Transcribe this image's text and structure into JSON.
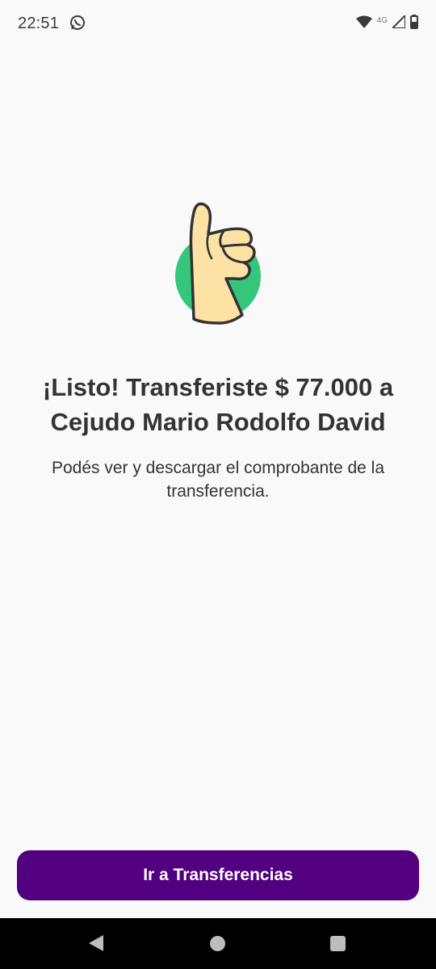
{
  "status_bar": {
    "time": "22:51",
    "network_label": "4G",
    "icons": [
      "whatsapp-icon",
      "wifi-icon",
      "signal-icon",
      "battery-icon"
    ]
  },
  "colors": {
    "accent": "#520080",
    "success_circle": "#34c77b",
    "hand_fill": "#fce3a5",
    "background": "#f9f9f9"
  },
  "illustration": {
    "icon": "thumbs-up-icon"
  },
  "confirmation": {
    "title_line1": "¡Listo! Transferiste $ 77.000 a",
    "title_line2": "Cejudo Mario Rodolfo David",
    "subtitle_line1": "Podés ver y descargar el comprobante de la",
    "subtitle_line2": "transferencia."
  },
  "actions": {
    "primary_label": "Ir a Transferencias"
  },
  "nav": {
    "icons": [
      "back-icon",
      "home-icon",
      "recents-icon"
    ]
  }
}
